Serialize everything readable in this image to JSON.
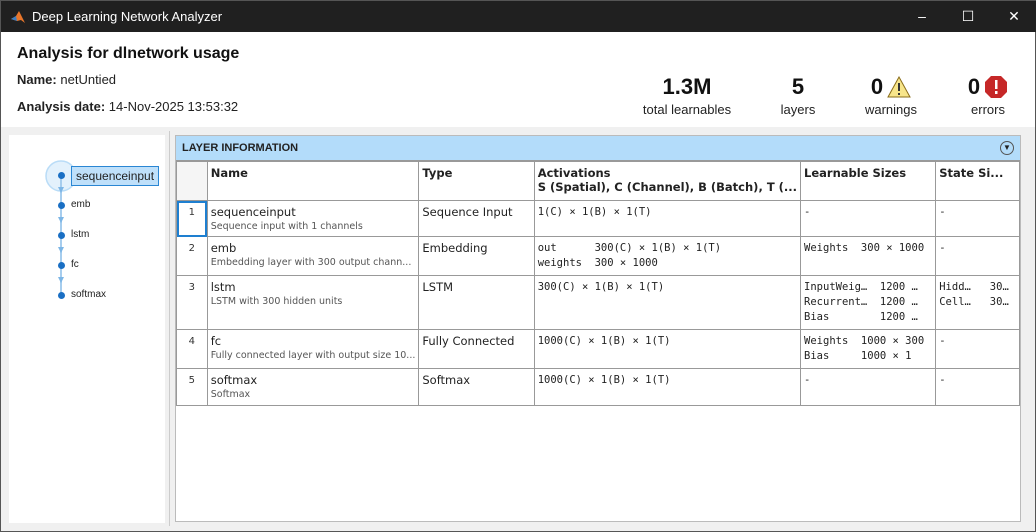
{
  "window": {
    "title": "Deep Learning Network Analyzer",
    "controls": [
      "–",
      "☐",
      "✕"
    ]
  },
  "header": {
    "title": "Analysis for dlnetwork usage",
    "name_label": "Name:",
    "name_value": "netUntied",
    "date_label": "Analysis date:",
    "date_value": "14-Nov-2025 13:53:32"
  },
  "stats": [
    {
      "value": "1.3M",
      "label": "total learnables"
    },
    {
      "value": "5",
      "label": "layers"
    },
    {
      "value": "0",
      "label": "warnings",
      "icon": "warning-icon"
    },
    {
      "value": "0",
      "label": "errors",
      "icon": "error-icon"
    }
  ],
  "colors": {
    "titlebar": "#202020",
    "band": "#b3dcfa",
    "selection": "#1e7fd0",
    "warning": "#f7e58b",
    "error": "#c62828"
  },
  "graph": {
    "nodes": [
      "sequenceinput",
      "emb",
      "lstm",
      "fc",
      "softmax"
    ],
    "selected": "sequenceinput"
  },
  "table": {
    "section": "LAYER INFORMATION",
    "columns": [
      "Name",
      "Type",
      "Activations",
      "Learnable Sizes",
      "State Si..."
    ],
    "activations_sub": "S (Spatial), C (Channel), B (Batch), T (...",
    "rows": [
      {
        "num": "1",
        "name": "sequenceinput",
        "desc": "Sequence input with 1 channels",
        "type": "Sequence Input",
        "activations": "1(C) × 1(B) × 1(T)",
        "learnables": "-",
        "states": "-"
      },
      {
        "num": "2",
        "name": "emb",
        "desc": "Embedding layer with 300 output chann...",
        "type": "Embedding",
        "activations": "out      300(C) × 1(B) × 1(T)\nweights  300 × 1000",
        "learnables": "Weights  300 × 1000",
        "states": "-"
      },
      {
        "num": "3",
        "name": "lstm",
        "desc": "LSTM with 300 hidden units",
        "type": "LSTM",
        "activations": "300(C) × 1(B) × 1(T)",
        "learnables": "InputWeig…  1200 …\nRecurrent…  1200 …\nBias        1200 …",
        "states": "Hidd…   30…\nCell…   30…"
      },
      {
        "num": "4",
        "name": "fc",
        "desc": "Fully connected layer with output size 10...",
        "type": "Fully Connected",
        "activations": "1000(C) × 1(B) × 1(T)",
        "learnables": "Weights  1000 × 300\nBias     1000 × 1",
        "states": "-"
      },
      {
        "num": "5",
        "name": "softmax",
        "desc": "Softmax",
        "type": "Softmax",
        "activations": "1000(C) × 1(B) × 1(T)",
        "learnables": "-",
        "states": "-"
      }
    ]
  }
}
